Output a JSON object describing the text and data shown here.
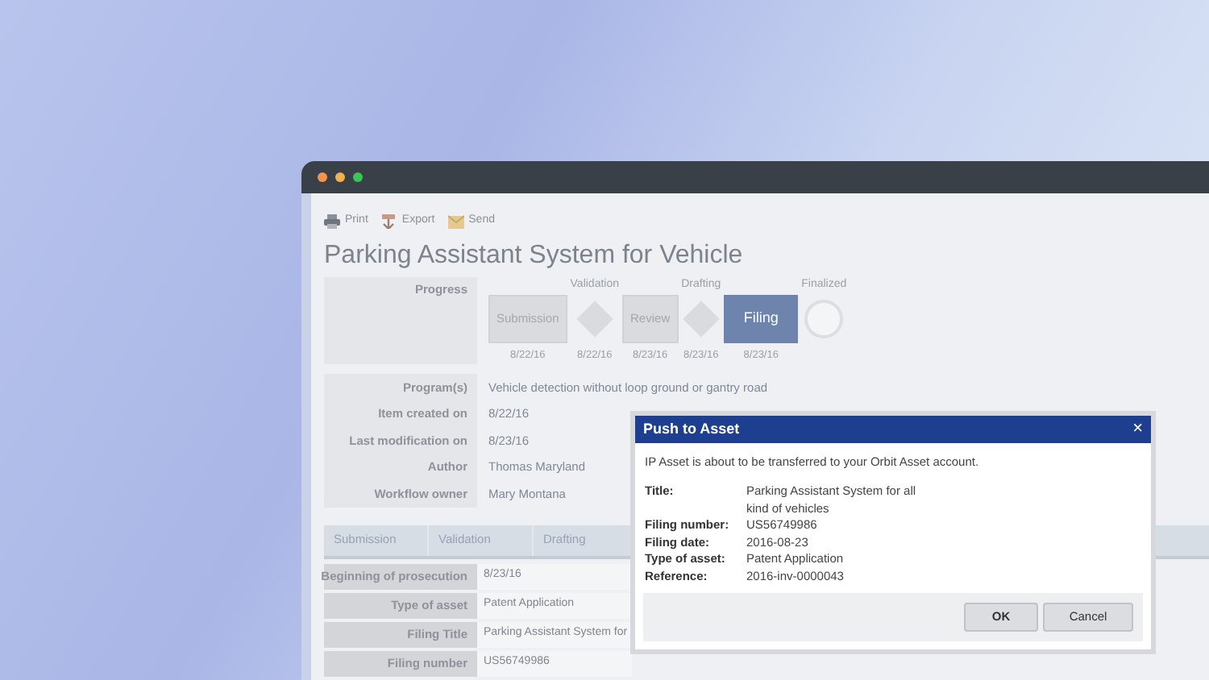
{
  "toolbar": [
    {
      "label": "Print"
    },
    {
      "label": "Export"
    },
    {
      "label": "Send"
    }
  ],
  "title": "Parking Assistant System for Vehicle",
  "progress": {
    "label": "Progress",
    "steps": [
      {
        "kind": "box",
        "label": "Submission",
        "date": "8/22/16",
        "selected": false
      },
      {
        "kind": "diamond",
        "above": "Validation",
        "date": "8/22/16"
      },
      {
        "kind": "box",
        "label": "Review",
        "date": "8/23/16",
        "selected": false
      },
      {
        "kind": "diamond",
        "above": "Drafting",
        "date": "8/23/16"
      },
      {
        "kind": "box",
        "label": "Filing",
        "date": "8/23/16",
        "selected": true
      },
      {
        "kind": "circle",
        "above": "Finalized"
      }
    ]
  },
  "fields": [
    {
      "label": "Program(s)",
      "value": "Vehicle detection without loop ground or gantry road"
    },
    {
      "label": "Item created on",
      "value": "8/22/16"
    },
    {
      "label": "Last modification on",
      "value": "8/23/16"
    },
    {
      "label": "Author",
      "value": "Thomas Maryland"
    },
    {
      "label": "Workflow owner",
      "value": "Mary Montana"
    }
  ],
  "tabs": [
    {
      "label": "Submission"
    },
    {
      "label": "Validation"
    },
    {
      "label": "Drafting"
    }
  ],
  "table": {
    "rows": [
      {
        "label": "Beginning of prosecution",
        "value": "8/23/16"
      },
      {
        "label": "Type of asset",
        "value": "Patent Application"
      },
      {
        "label": "Filing Title",
        "value": "Parking Assistant System for"
      },
      {
        "label": "Filing number",
        "value": "US56749986"
      }
    ]
  },
  "dialog": {
    "title": "Push to Asset",
    "close": "×",
    "message": "IP Asset is about to be transferred to your Orbit Asset account.",
    "details": [
      {
        "label": "Title:",
        "value": "Parking Assistant System for all kind of vehicles"
      },
      {
        "label": "Filing number:",
        "value": "US56749986"
      },
      {
        "label": "Filing date:",
        "value": "2016-08-23"
      },
      {
        "label": "Type of asset:",
        "value": "Patent Application"
      },
      {
        "label": "Reference:",
        "value": "2016-inv-0000043"
      }
    ],
    "buttons": [
      "OK",
      "Cancel"
    ]
  }
}
